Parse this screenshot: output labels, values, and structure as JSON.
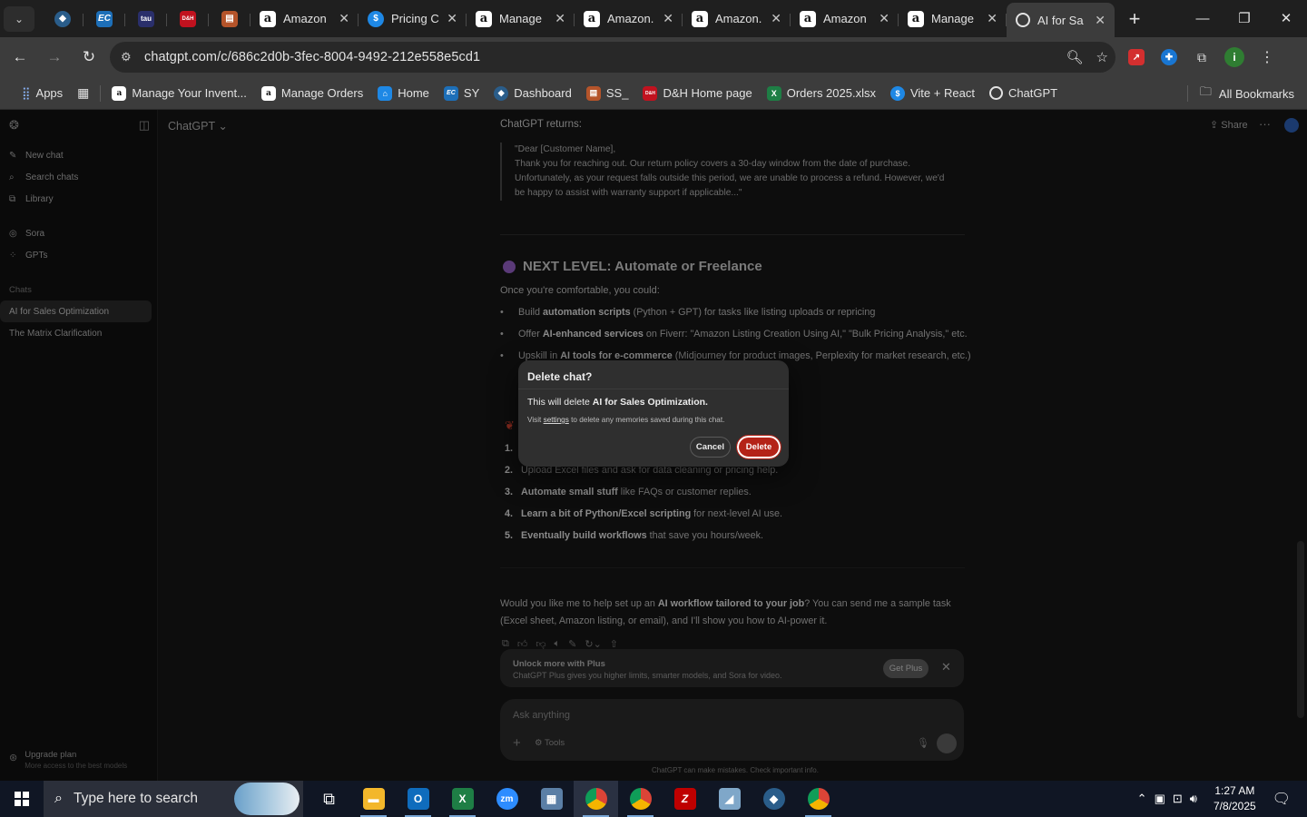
{
  "browser": {
    "pinned_tabs": [
      {
        "icon": "hexagon-app-icon",
        "color": "#2a5d8a"
      },
      {
        "icon": "ec-icon",
        "label": "EC",
        "color": "#1d6fb8"
      },
      {
        "icon": "tau-icon",
        "label": "tau",
        "color": "#2a2f6b"
      },
      {
        "icon": "dh-icon",
        "label": "D&H",
        "color": "#c1121f"
      },
      {
        "icon": "box-stack-icon",
        "color": "#b5542a"
      }
    ],
    "tabs": [
      {
        "label": "Amazon",
        "icon": "amazon-icon"
      },
      {
        "label": "Pricing C",
        "icon": "dollar-icon"
      },
      {
        "label": "Manage",
        "icon": "amazon-icon"
      },
      {
        "label": "Amazon.",
        "icon": "amazon-icon"
      },
      {
        "label": "Amazon.",
        "icon": "amazon-icon"
      },
      {
        "label": "Amazon",
        "icon": "amazon-icon"
      },
      {
        "label": "Manage",
        "icon": "amazon-icon"
      },
      {
        "label": "AI for Sa",
        "icon": "chatgpt-icon",
        "active": true
      }
    ],
    "url": "chatgpt.com/c/686c2d0b-3fec-8004-9492-212e558e5cd1",
    "bookmarks": [
      {
        "label": "Apps",
        "icon": "apps-grid-icon"
      },
      {
        "label": "Manage Your Invent...",
        "icon": "amazon-icon"
      },
      {
        "label": "Manage Orders",
        "icon": "amazon-icon"
      },
      {
        "label": "Home",
        "icon": "home-doc-icon"
      },
      {
        "label": "SY",
        "icon": "ec-icon"
      },
      {
        "label": "Dashboard",
        "icon": "dashboard-icon"
      },
      {
        "label": "SS_",
        "icon": "box-stack-icon"
      },
      {
        "label": "D&H Home page",
        "icon": "dh-icon"
      },
      {
        "label": "Orders 2025.xlsx",
        "icon": "excel-icon"
      },
      {
        "label": "Vite + React",
        "icon": "dollar-icon"
      },
      {
        "label": "ChatGPT",
        "icon": "chatgpt-icon"
      }
    ],
    "all_bookmarks": "All Bookmarks"
  },
  "sidebar": {
    "new_chat": "New chat",
    "search_chats": "Search chats",
    "library": "Library",
    "sora": "Sora",
    "gpts": "GPTs",
    "chats_heading": "Chats",
    "chats": [
      "AI for Sales Optimization",
      "The Matrix Clarification"
    ],
    "upgrade_title": "Upgrade plan",
    "upgrade_sub": "More access to the best models"
  },
  "header": {
    "model": "ChatGPT ⌄",
    "share": "Share"
  },
  "conversation": {
    "returns_label": "ChatGPT returns:",
    "quote_lines": [
      "\"Dear [Customer Name],",
      "Thank you for reaching out. Our return policy covers a 30-day window from the date of purchase.",
      "Unfortunately, as your request falls outside this period, we are unable to process a refund. However, we'd",
      "be happy to assist with warranty support if applicable...\""
    ],
    "next_level_heading": "NEXT LEVEL: Automate or Freelance",
    "next_level_intro": "Once you're comfortable, you could:",
    "bullets": [
      {
        "pre": "Build ",
        "bold": "automation scripts",
        "post": " (Python + GPT) for tasks like listing uploads or repricing"
      },
      {
        "pre": "Offer ",
        "bold": "AI-enhanced services",
        "post": " on Fiverr: \"Amazon Listing Creation Using AI,\" \"Bulk Pricing Analysis,\" etc."
      },
      {
        "pre": "Upskill in ",
        "bold": "AI tools for e-commerce",
        "post": " (Midjourney for product images, Perplexity for market research, etc.)"
      }
    ],
    "steps": [
      {
        "n": "2.",
        "bold": "",
        "text": "Upload Excel files and ask for data cleaning or pricing help."
      },
      {
        "n": "3.",
        "bold": "Automate small stuff",
        "text": " like FAQs or customer replies."
      },
      {
        "n": "4.",
        "bold": "Learn a bit of Python/Excel scripting",
        "text": " for next-level AI use."
      },
      {
        "n": "5.",
        "bold": "Eventually build workflows",
        "text": " that save you hours/week."
      }
    ],
    "step1_number": "1.",
    "final_pre": "Would you like me to help set up an ",
    "final_bold": "AI workflow tailored to your job",
    "final_post": "? You can send me a sample task (Excel sheet, Amazon listing, or email), and I'll show you how to AI-power it."
  },
  "plus_banner": {
    "title": "Unlock more with Plus",
    "subtitle": "ChatGPT Plus gives you higher limits, smarter models, and Sora for video.",
    "button": "Get Plus"
  },
  "composer": {
    "placeholder": "Ask anything",
    "tools": "Tools"
  },
  "disclaimer": "ChatGPT can make mistakes. Check important info.",
  "modal": {
    "title": "Delete chat?",
    "line1_pre": "This will delete ",
    "line1_bold": "AI for Sales Optimization.",
    "line2_pre": "Visit ",
    "line2_link": "settings",
    "line2_post": " to delete any memories saved during this chat.",
    "cancel": "Cancel",
    "delete": "Delete",
    "danger_color": "#b42318"
  },
  "taskbar": {
    "search_placeholder": "Type here to search",
    "time": "1:27 AM",
    "date": "7/8/2025"
  }
}
